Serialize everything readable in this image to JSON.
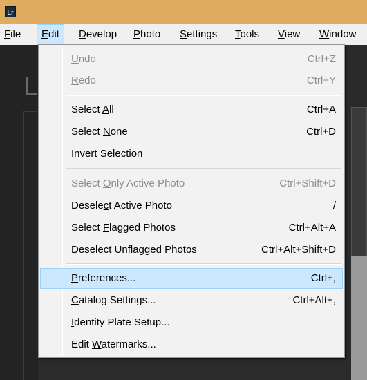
{
  "title_bar": {
    "app_icon_text": "Lr",
    "color": "#e0ad60"
  },
  "menubar": {
    "items": [
      {
        "label": "File"
      },
      {
        "label": "Edit"
      },
      {
        "label": "Develop"
      },
      {
        "label": "Photo"
      },
      {
        "label": "Settings"
      },
      {
        "label": "Tools"
      },
      {
        "label": "View"
      },
      {
        "label": "Window"
      }
    ],
    "active": "Edit"
  },
  "background": {
    "lr_fragment": "L"
  },
  "edit_menu": {
    "items": [
      {
        "label": "Undo",
        "shortcut": "Ctrl+Z",
        "enabled": false
      },
      {
        "label": "Redo",
        "shortcut": "Ctrl+Y",
        "enabled": false
      },
      {
        "label": "Select All",
        "shortcut": "Ctrl+A",
        "enabled": true
      },
      {
        "label": "Select None",
        "shortcut": "Ctrl+D",
        "enabled": true
      },
      {
        "label": "Invert Selection",
        "shortcut": "",
        "enabled": true
      },
      {
        "label": "Select Only Active Photo",
        "shortcut": "Ctrl+Shift+D",
        "enabled": false
      },
      {
        "label": "Deselect Active Photo",
        "shortcut": "/",
        "enabled": true
      },
      {
        "label": "Select Flagged Photos",
        "shortcut": "Ctrl+Alt+A",
        "enabled": true
      },
      {
        "label": "Deselect Unflagged Photos",
        "shortcut": "Ctrl+Alt+Shift+D",
        "enabled": true
      },
      {
        "label": "Preferences...",
        "shortcut": "Ctrl+,",
        "enabled": true,
        "highlighted": true
      },
      {
        "label": "Catalog Settings...",
        "shortcut": "Ctrl+Alt+,",
        "enabled": true
      },
      {
        "label": "Identity Plate Setup...",
        "shortcut": "",
        "enabled": true
      },
      {
        "label": "Edit Watermarks...",
        "shortcut": "",
        "enabled": true
      }
    ],
    "highlight_color": "#cce8ff"
  }
}
